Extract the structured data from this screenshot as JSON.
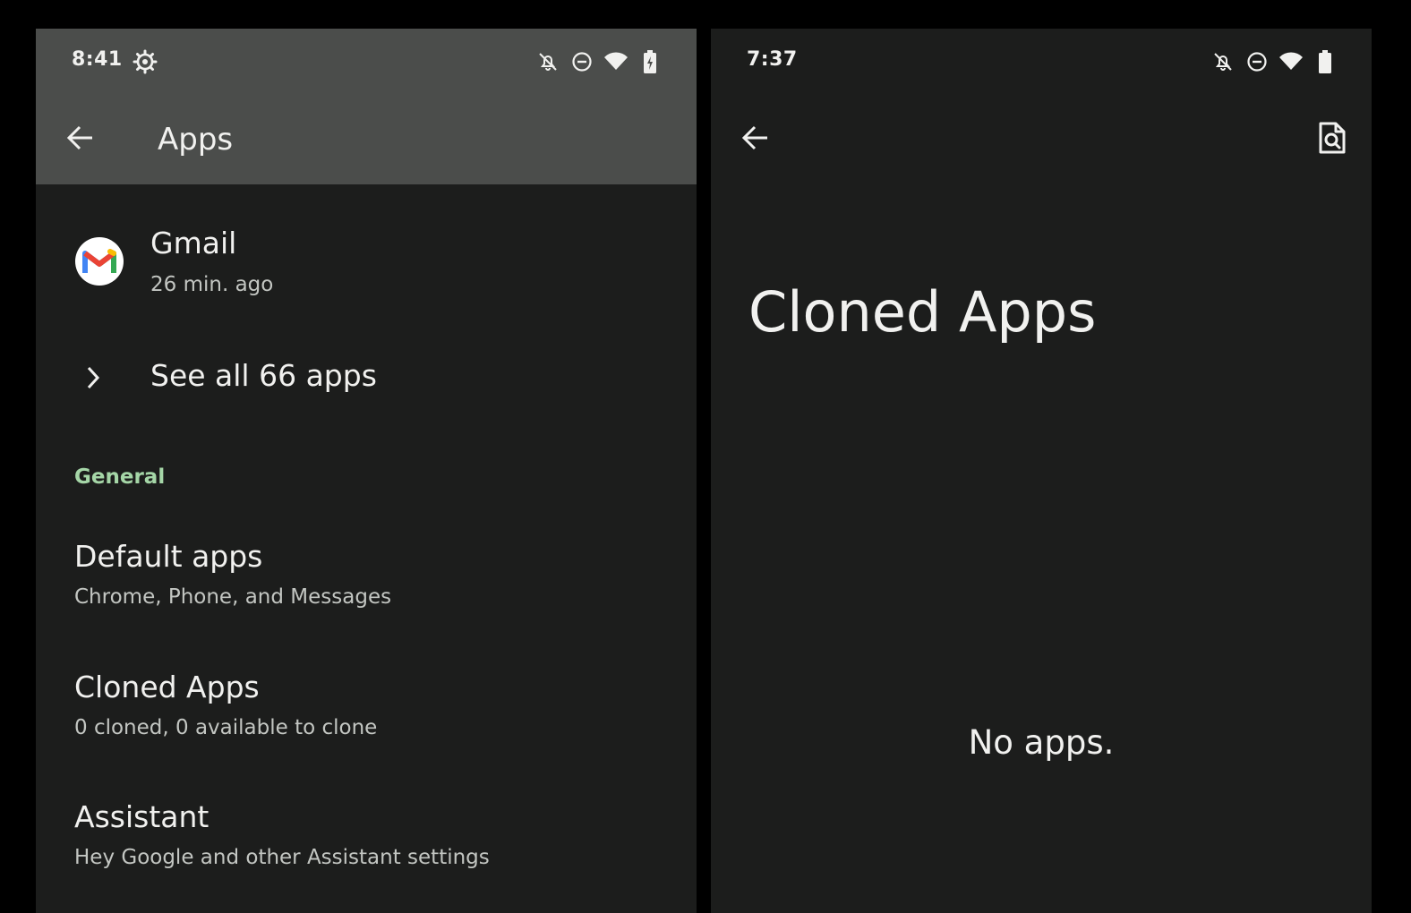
{
  "left_screen": {
    "status_bar": {
      "time": "8:41",
      "icons": [
        "settings-gear-icon",
        "notifications-off-icon",
        "do-not-disturb-icon",
        "wifi-icon",
        "battery-charging-icon"
      ]
    },
    "app_bar": {
      "title": "Apps"
    },
    "recent_app": {
      "name": "Gmail",
      "last_used": "26 min. ago"
    },
    "see_all": {
      "label": "See all 66 apps"
    },
    "section": {
      "header": "General"
    },
    "items": [
      {
        "title": "Default apps",
        "subtitle": "Chrome, Phone, and Messages"
      },
      {
        "title": "Cloned Apps",
        "subtitle": "0 cloned, 0 available to clone"
      },
      {
        "title": "Assistant",
        "subtitle": "Hey Google and other Assistant settings"
      }
    ]
  },
  "right_screen": {
    "status_bar": {
      "time": "7:37",
      "icons": [
        "notifications-off-icon",
        "do-not-disturb-icon",
        "wifi-icon",
        "battery-full-icon"
      ]
    },
    "title": "Cloned Apps",
    "empty_message": "No apps."
  },
  "colors": {
    "screen_background": "#1c1d1c",
    "app_bar_background": "#4b4d4b",
    "accent_green": "#a5d6a7",
    "text_primary": "#f1f1ef",
    "text_secondary": "#c3c6c2"
  }
}
